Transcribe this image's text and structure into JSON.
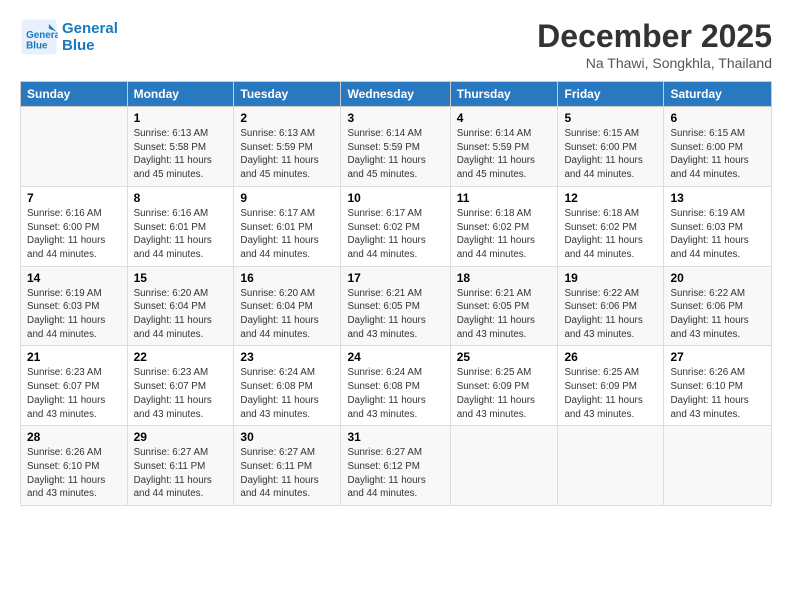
{
  "header": {
    "logo_line1": "General",
    "logo_line2": "Blue",
    "month": "December 2025",
    "location": "Na Thawi, Songkhla, Thailand"
  },
  "weekdays": [
    "Sunday",
    "Monday",
    "Tuesday",
    "Wednesday",
    "Thursday",
    "Friday",
    "Saturday"
  ],
  "weeks": [
    [
      {
        "day": "",
        "info": ""
      },
      {
        "day": "1",
        "info": "Sunrise: 6:13 AM\nSunset: 5:58 PM\nDaylight: 11 hours\nand 45 minutes."
      },
      {
        "day": "2",
        "info": "Sunrise: 6:13 AM\nSunset: 5:59 PM\nDaylight: 11 hours\nand 45 minutes."
      },
      {
        "day": "3",
        "info": "Sunrise: 6:14 AM\nSunset: 5:59 PM\nDaylight: 11 hours\nand 45 minutes."
      },
      {
        "day": "4",
        "info": "Sunrise: 6:14 AM\nSunset: 5:59 PM\nDaylight: 11 hours\nand 45 minutes."
      },
      {
        "day": "5",
        "info": "Sunrise: 6:15 AM\nSunset: 6:00 PM\nDaylight: 11 hours\nand 44 minutes."
      },
      {
        "day": "6",
        "info": "Sunrise: 6:15 AM\nSunset: 6:00 PM\nDaylight: 11 hours\nand 44 minutes."
      }
    ],
    [
      {
        "day": "7",
        "info": "Sunrise: 6:16 AM\nSunset: 6:00 PM\nDaylight: 11 hours\nand 44 minutes."
      },
      {
        "day": "8",
        "info": "Sunrise: 6:16 AM\nSunset: 6:01 PM\nDaylight: 11 hours\nand 44 minutes."
      },
      {
        "day": "9",
        "info": "Sunrise: 6:17 AM\nSunset: 6:01 PM\nDaylight: 11 hours\nand 44 minutes."
      },
      {
        "day": "10",
        "info": "Sunrise: 6:17 AM\nSunset: 6:02 PM\nDaylight: 11 hours\nand 44 minutes."
      },
      {
        "day": "11",
        "info": "Sunrise: 6:18 AM\nSunset: 6:02 PM\nDaylight: 11 hours\nand 44 minutes."
      },
      {
        "day": "12",
        "info": "Sunrise: 6:18 AM\nSunset: 6:02 PM\nDaylight: 11 hours\nand 44 minutes."
      },
      {
        "day": "13",
        "info": "Sunrise: 6:19 AM\nSunset: 6:03 PM\nDaylight: 11 hours\nand 44 minutes."
      }
    ],
    [
      {
        "day": "14",
        "info": "Sunrise: 6:19 AM\nSunset: 6:03 PM\nDaylight: 11 hours\nand 44 minutes."
      },
      {
        "day": "15",
        "info": "Sunrise: 6:20 AM\nSunset: 6:04 PM\nDaylight: 11 hours\nand 44 minutes."
      },
      {
        "day": "16",
        "info": "Sunrise: 6:20 AM\nSunset: 6:04 PM\nDaylight: 11 hours\nand 44 minutes."
      },
      {
        "day": "17",
        "info": "Sunrise: 6:21 AM\nSunset: 6:05 PM\nDaylight: 11 hours\nand 43 minutes."
      },
      {
        "day": "18",
        "info": "Sunrise: 6:21 AM\nSunset: 6:05 PM\nDaylight: 11 hours\nand 43 minutes."
      },
      {
        "day": "19",
        "info": "Sunrise: 6:22 AM\nSunset: 6:06 PM\nDaylight: 11 hours\nand 43 minutes."
      },
      {
        "day": "20",
        "info": "Sunrise: 6:22 AM\nSunset: 6:06 PM\nDaylight: 11 hours\nand 43 minutes."
      }
    ],
    [
      {
        "day": "21",
        "info": "Sunrise: 6:23 AM\nSunset: 6:07 PM\nDaylight: 11 hours\nand 43 minutes."
      },
      {
        "day": "22",
        "info": "Sunrise: 6:23 AM\nSunset: 6:07 PM\nDaylight: 11 hours\nand 43 minutes."
      },
      {
        "day": "23",
        "info": "Sunrise: 6:24 AM\nSunset: 6:08 PM\nDaylight: 11 hours\nand 43 minutes."
      },
      {
        "day": "24",
        "info": "Sunrise: 6:24 AM\nSunset: 6:08 PM\nDaylight: 11 hours\nand 43 minutes."
      },
      {
        "day": "25",
        "info": "Sunrise: 6:25 AM\nSunset: 6:09 PM\nDaylight: 11 hours\nand 43 minutes."
      },
      {
        "day": "26",
        "info": "Sunrise: 6:25 AM\nSunset: 6:09 PM\nDaylight: 11 hours\nand 43 minutes."
      },
      {
        "day": "27",
        "info": "Sunrise: 6:26 AM\nSunset: 6:10 PM\nDaylight: 11 hours\nand 43 minutes."
      }
    ],
    [
      {
        "day": "28",
        "info": "Sunrise: 6:26 AM\nSunset: 6:10 PM\nDaylight: 11 hours\nand 43 minutes."
      },
      {
        "day": "29",
        "info": "Sunrise: 6:27 AM\nSunset: 6:11 PM\nDaylight: 11 hours\nand 44 minutes."
      },
      {
        "day": "30",
        "info": "Sunrise: 6:27 AM\nSunset: 6:11 PM\nDaylight: 11 hours\nand 44 minutes."
      },
      {
        "day": "31",
        "info": "Sunrise: 6:27 AM\nSunset: 6:12 PM\nDaylight: 11 hours\nand 44 minutes."
      },
      {
        "day": "",
        "info": ""
      },
      {
        "day": "",
        "info": ""
      },
      {
        "day": "",
        "info": ""
      }
    ]
  ]
}
